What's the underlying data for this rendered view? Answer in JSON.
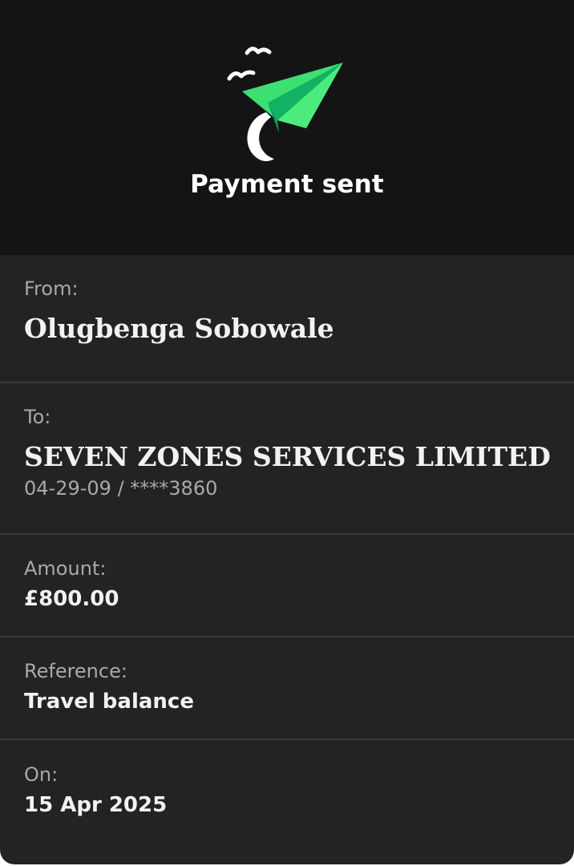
{
  "header": {
    "icon": "paper-plane-icon",
    "title": "Payment sent"
  },
  "details": {
    "from": {
      "label": "From:",
      "name": "Olugbenga Sobowale"
    },
    "to": {
      "label": "To:",
      "name": "SEVEN ZONES SERVICES LIMITED",
      "account": "04-29-09 / ****3860"
    },
    "amount": {
      "label": "Amount:",
      "value": "£800.00"
    },
    "reference": {
      "label": "Reference:",
      "value": "Travel balance"
    },
    "date": {
      "label": "On:",
      "value": "15 Apr 2025"
    }
  },
  "colors": {
    "header_background": "#141414",
    "card_background": "#232323",
    "plane_green": "#3ddf72",
    "plane_dark_green": "#11b062",
    "divider": "#3b3b3b"
  }
}
